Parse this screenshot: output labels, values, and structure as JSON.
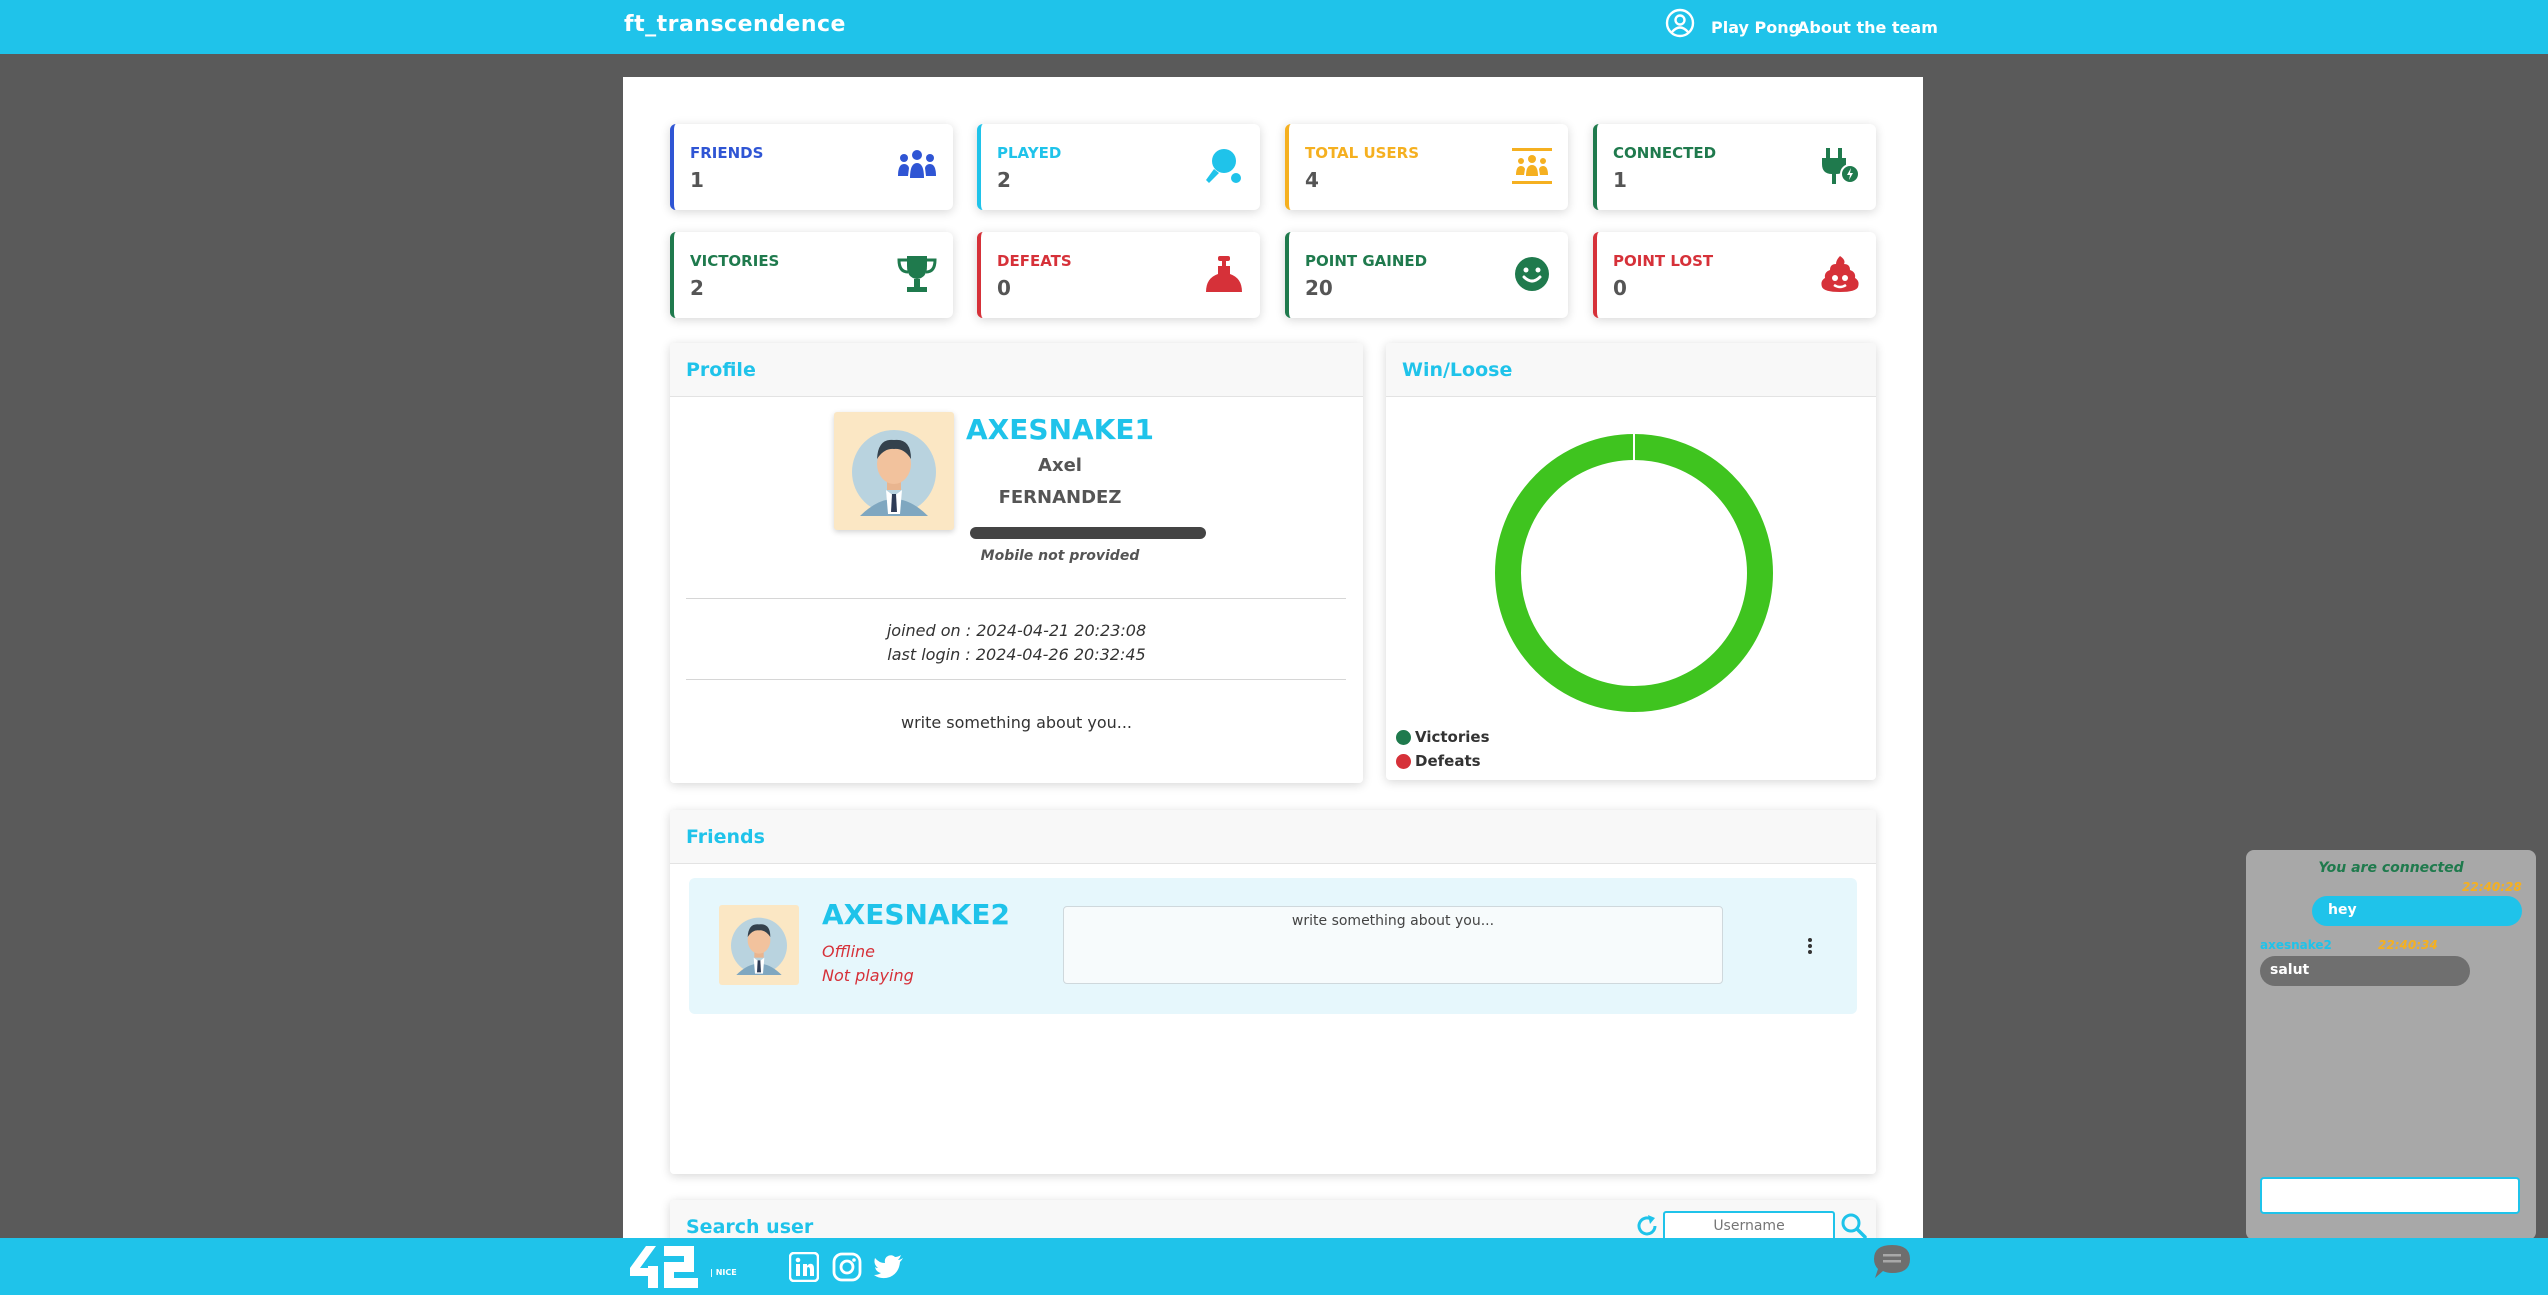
{
  "app": {
    "title": "ft_transcendence"
  },
  "nav": {
    "play": "Play Pong",
    "about": "About the team"
  },
  "stats": [
    {
      "label": "FRIENDS",
      "value": "1",
      "color": "#2f55d4",
      "icon": "users-icon"
    },
    {
      "label": "PLAYED",
      "value": "2",
      "color": "#1fc3ea",
      "icon": "ping-pong-icon"
    },
    {
      "label": "TOTAL USERS",
      "value": "4",
      "color": "#f5b020",
      "icon": "users-rectangle-icon"
    },
    {
      "label": "CONNECTED",
      "value": "1",
      "color": "#1f7a4d",
      "icon": "plug-icon"
    },
    {
      "label": "VICTORIES",
      "value": "2",
      "color": "#1f7a4d",
      "icon": "trophy-icon"
    },
    {
      "label": "DEFEATS",
      "value": "0",
      "color": "#d63139",
      "icon": "bell-icon"
    },
    {
      "label": "POINT GAINED",
      "value": "20",
      "color": "#1f7a4d",
      "icon": "smile-icon"
    },
    {
      "label": "POINT LOST",
      "value": "0",
      "color": "#d63139",
      "icon": "poop-icon"
    }
  ],
  "profile": {
    "title": "Profile",
    "username": "AXESNAKE1",
    "first_name": "Axel",
    "last_name": "FERNANDEZ",
    "mobile": "Mobile not provided",
    "joined": "joined on : 2024-04-21 20:23:08",
    "last_login": "last login : 2024-04-26 20:32:45",
    "bio": "write something about you..."
  },
  "winloose": {
    "title": "Win/Loose",
    "legend": [
      {
        "label": "Victories",
        "color": "#1f7a4d"
      },
      {
        "label": "Defeats",
        "color": "#d63139"
      }
    ]
  },
  "chart_data": {
    "type": "pie",
    "categories": [
      "Victories",
      "Defeats"
    ],
    "values": [
      2,
      0
    ],
    "colors": [
      "#3fc41f",
      "#d63139"
    ],
    "title": "Win/Loose"
  },
  "friends": {
    "title": "Friends",
    "items": [
      {
        "username": "AXESNAKE2",
        "status": "Offline",
        "playing": "Not playing",
        "bio": "write something about you..."
      }
    ]
  },
  "search": {
    "title": "Search user",
    "placeholder": "Username"
  },
  "chat": {
    "connected": "You are connected",
    "messages": [
      {
        "side": "right",
        "text": "hey",
        "time": "22:40:28",
        "author": ""
      },
      {
        "side": "left",
        "text": "salut",
        "time": "22:40:34",
        "author": "axesnake2"
      }
    ]
  },
  "footer": {
    "school": "| NICE"
  }
}
